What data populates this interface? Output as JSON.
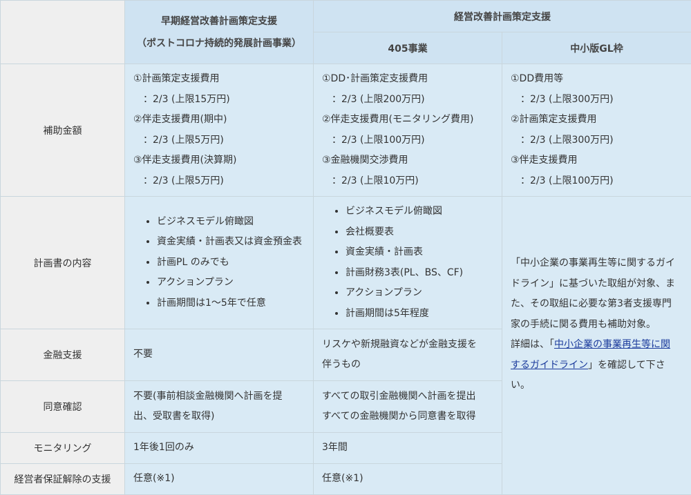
{
  "header": {
    "col1_title_line1": "早期経営改善計画策定支援",
    "col1_title_line2": "（ポストコロナ持続的発展計画事業）",
    "group_title": "経営改善計画策定支援",
    "col2_title": "405事業",
    "col3_title": "中小版GL枠"
  },
  "rows": {
    "subsidy": {
      "label": "補助金額",
      "col1": [
        "①計画策定支援費用",
        "：2/3 (上限15万円)",
        "②伴走支援費用(期中)",
        "：2/3 (上限5万円)",
        "③伴走支援費用(決算期)",
        "：2/3 (上限5万円)"
      ],
      "col2": [
        "①DD･計画策定支援費用",
        "：2/3 (上限200万円)",
        "②伴走支援費用(モニタリング費用)",
        "：2/3 (上限100万円)",
        "③金融機関交渉費用",
        "：2/3 (上限10万円)"
      ],
      "col3": [
        "①DD費用等",
        "：2/3 (上限300万円)",
        "②計画策定支援費用",
        "：2/3 (上限300万円)",
        "③伴走支援費用",
        "：2/3 (上限100万円)"
      ]
    },
    "plan": {
      "label": "計画書の内容",
      "col1": [
        "ビジネスモデル俯瞰図",
        "資金実績・計画表又は資金預金表",
        "計画PL のみでも",
        "アクションプラン",
        "計画期間は1～5年で任意"
      ],
      "col2": [
        "ビジネスモデル俯瞰図",
        "会社概要表",
        "資金実績・計画表",
        "計画財務3表(PL、BS、CF)",
        "アクションプラン",
        "計画期間は5年程度"
      ]
    },
    "financial": {
      "label": "金融支援",
      "col1": "不要",
      "col2": [
        "リスケや新規融資などが金融支援を",
        "伴うもの"
      ]
    },
    "consent": {
      "label": "同意確認",
      "col1": [
        "不要(事前相談金融機関へ計画を提",
        "出、受取書を取得)"
      ],
      "col2": [
        "すべての取引金融機関へ計画を提出",
        "すべての金融機関から同意書を取得"
      ]
    },
    "monitoring": {
      "label": "モニタリング",
      "col1": "1年後1回のみ",
      "col2": "3年間"
    },
    "guarantee": {
      "label": "経営者保証解除の支援",
      "col1": "任意(※1)",
      "col2": "任意(※1)"
    },
    "gl_note": {
      "lines": [
        "「中小企業の事業再生等に関するガイ",
        "ドライン」に基づいた取組が対象、ま",
        "た、その取組に必要な第3者支援専門",
        "家の手続に関る費用も補助対象。"
      ],
      "detail_prefix": "詳細は、「",
      "link_line1": "中小企業の事業再生等に関",
      "link_line2": "するガイドライン",
      "detail_suffix1": "」を確認して下さ",
      "detail_suffix2": "い。"
    }
  }
}
